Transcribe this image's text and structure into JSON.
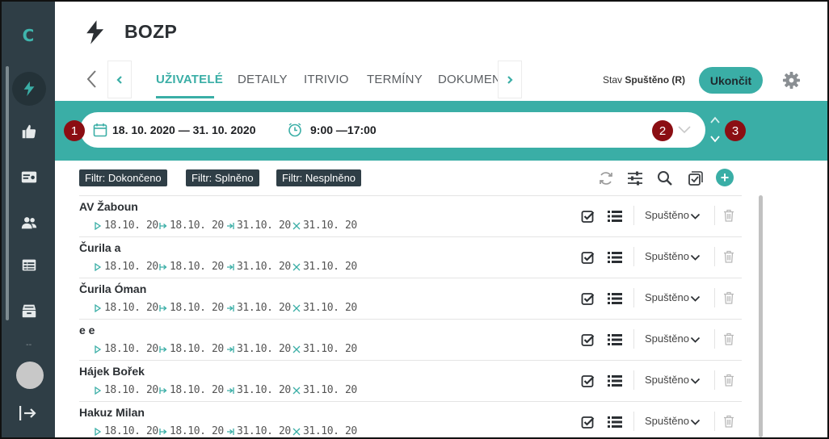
{
  "sidebar": {
    "logo": "C",
    "items": [
      {
        "icon": "bolt-icon",
        "active": true
      },
      {
        "icon": "thumbs-up-icon",
        "active": false
      },
      {
        "icon": "id-card-icon",
        "active": false
      },
      {
        "icon": "users-icon",
        "active": false
      },
      {
        "icon": "table-icon",
        "active": false
      },
      {
        "icon": "archive-icon",
        "active": false
      }
    ],
    "more": "--"
  },
  "header": {
    "title": "BOZP",
    "icon": "bolt-icon"
  },
  "tabs": [
    {
      "label": "UŽIVATELÉ",
      "active": true
    },
    {
      "label": "DETAILY",
      "active": false
    },
    {
      "label": "ITRIVIO",
      "active": false
    },
    {
      "label": "TERMÍNY",
      "active": false
    },
    {
      "label": "DOKUMENTY",
      "active": false
    }
  ],
  "status": {
    "prefix": "Stav",
    "value": "Spuštěno (R)"
  },
  "end_button": "Ukončit",
  "period": {
    "date_range": "18. 10. 2020 — 31. 10. 2020",
    "time_range": "9:00 —17:00"
  },
  "badges": [
    "1",
    "2",
    "3"
  ],
  "filters": [
    "Filtr: Dokončeno",
    "Filtr: Splněno",
    "Filtr: Nesplněno"
  ],
  "add_label": "+",
  "rows": [
    {
      "name": "AV Žaboun",
      "start": "18.10. 20",
      "from": "18.10. 20",
      "to": "31.10. 20",
      "end": "31.10. 20",
      "status": "Spuštěno"
    },
    {
      "name": "Čurila a",
      "start": "18.10. 20",
      "from": "18.10. 20",
      "to": "31.10. 20",
      "end": "31.10. 20",
      "status": "Spuštěno"
    },
    {
      "name": "Čurila Óman",
      "start": "18.10. 20",
      "from": "18.10. 20",
      "to": "31.10. 20",
      "end": "31.10. 20",
      "status": "Spuštěno"
    },
    {
      "name": "e e",
      "start": "18.10. 20",
      "from": "18.10. 20",
      "to": "31.10. 20",
      "end": "31.10. 20",
      "status": "Spuštěno"
    },
    {
      "name": "Hájek Bořek",
      "start": "18.10. 20",
      "from": "18.10. 20",
      "to": "31.10. 20",
      "end": "31.10. 20",
      "status": "Spuštěno"
    },
    {
      "name": "Hakuz Milan",
      "start": "18.10. 20",
      "from": "18.10. 20",
      "to": "31.10. 20",
      "end": "31.10. 20",
      "status": "Spuštěno"
    }
  ],
  "colors": {
    "accent": "#3aaea6",
    "sidebar": "#2f3e46",
    "badge": "#8b0e13"
  }
}
